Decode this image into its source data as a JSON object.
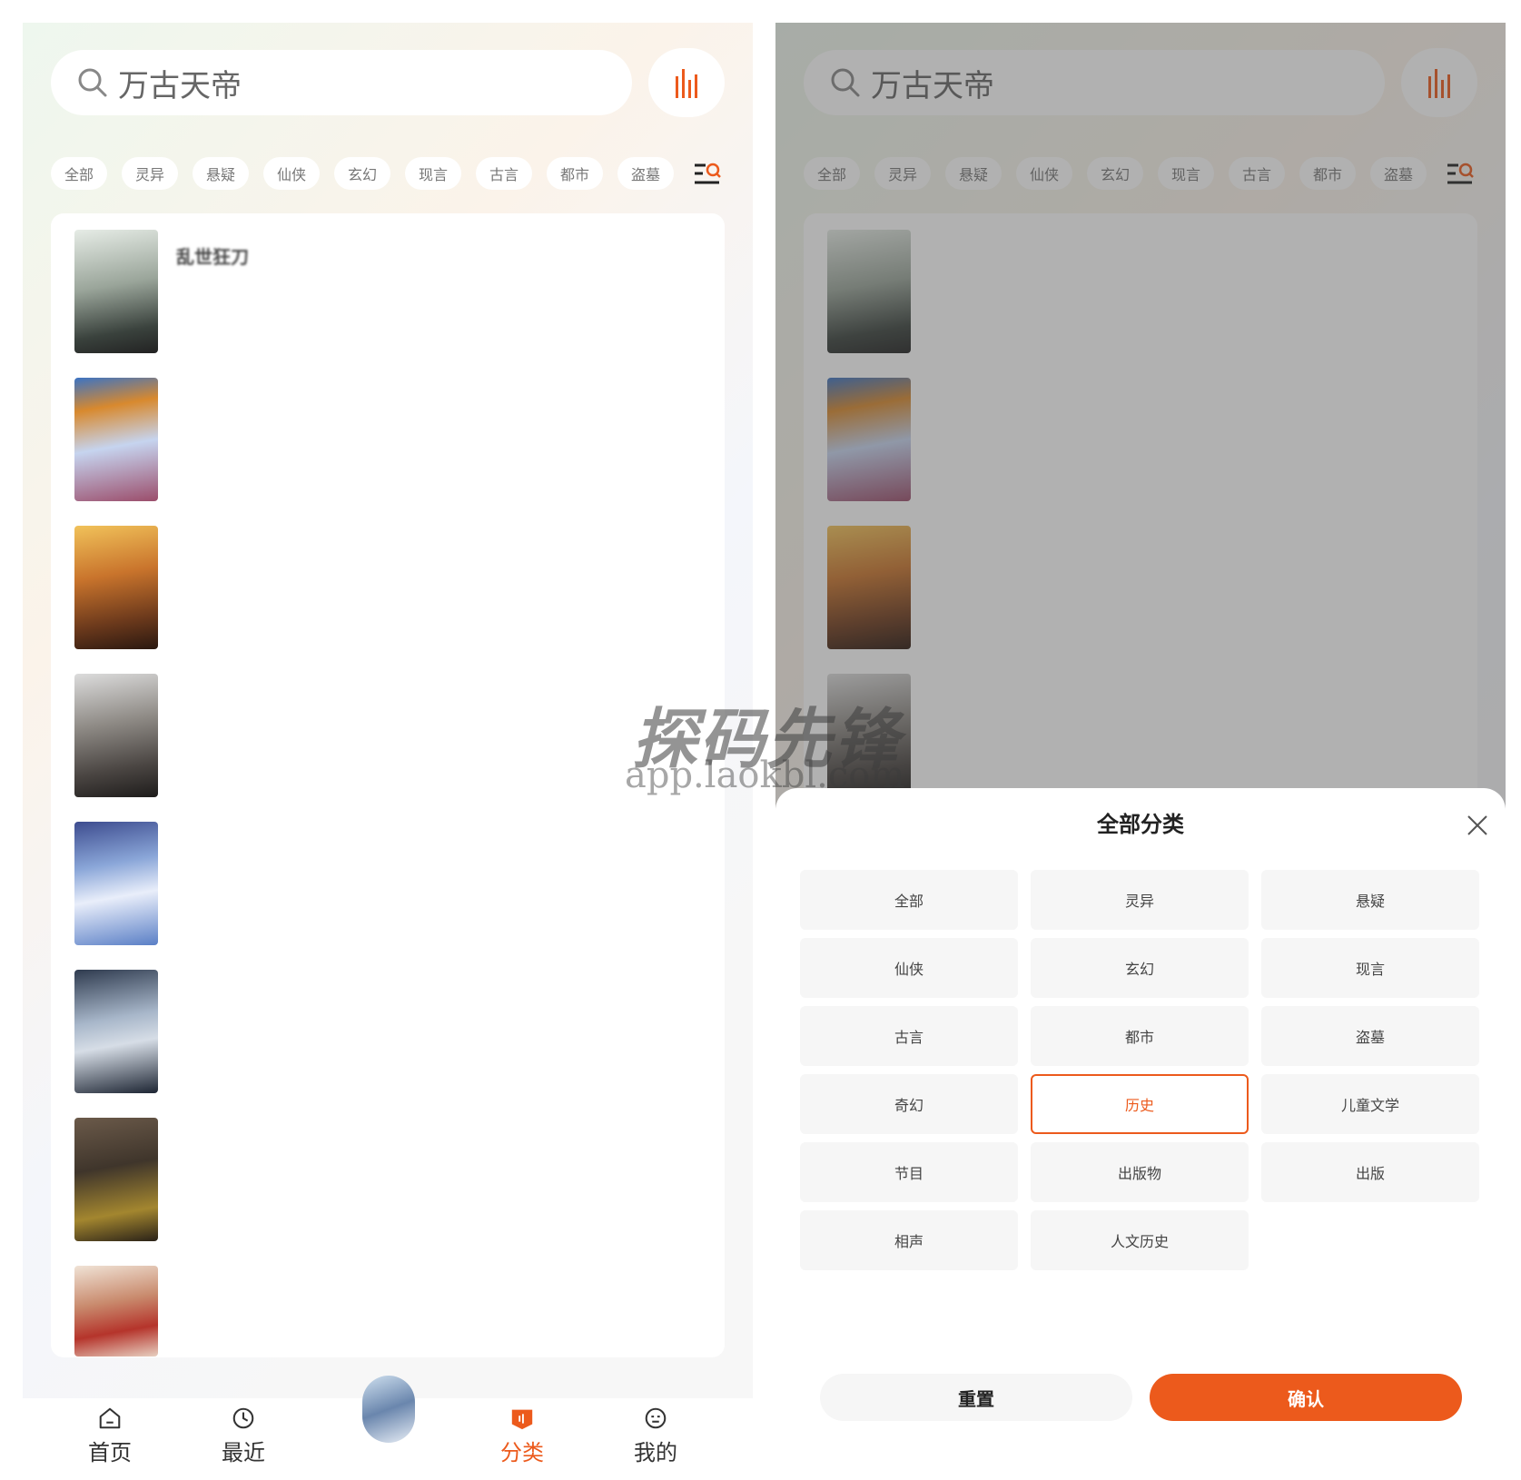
{
  "search": {
    "placeholder": "万古天帝"
  },
  "chips": [
    "全部",
    "灵异",
    "悬疑",
    "仙侠",
    "玄幻",
    "现言",
    "古言",
    "都市",
    "盗墓"
  ],
  "books": [
    {
      "title": "乱世狂刀",
      "desc": "",
      "count": ""
    },
    {
      "title": "",
      "desc": "",
      "count": ""
    },
    {
      "title": "",
      "desc": "",
      "count": ""
    },
    {
      "title": "",
      "desc": "",
      "count": ""
    },
    {
      "title": "",
      "desc": "",
      "count": ""
    },
    {
      "title": "",
      "desc": "",
      "count": ""
    },
    {
      "title": "",
      "desc": "",
      "count": ""
    },
    {
      "title": "",
      "desc": "",
      "count": ""
    }
  ],
  "tabbar": {
    "home": "首页",
    "recent": "最近",
    "category": "分类",
    "mine": "我的"
  },
  "sheet": {
    "title": "全部分类",
    "categories": [
      "全部",
      "灵异",
      "悬疑",
      "仙侠",
      "玄幻",
      "现言",
      "古言",
      "都市",
      "盗墓",
      "奇幻",
      "历史",
      "儿童文学",
      "节目",
      "出版物",
      "出版",
      "相声",
      "人文历史"
    ],
    "selected": "历史",
    "reset": "重置",
    "confirm": "确认"
  },
  "watermark": {
    "cn": "探码先锋",
    "en": "app.laokbl.com"
  },
  "colors": {
    "accent": "#ec5a1c",
    "card": "#ffffff",
    "chip_bg": "#ffffff",
    "sheet_cell": "#f6f6f6"
  },
  "icons": {
    "search": "search-icon",
    "voice": "voice-bars-icon",
    "filter": "filter-search-icon",
    "home": "home-icon",
    "recent": "clock-icon",
    "category": "category-icon",
    "mine": "profile-icon",
    "close": "close-icon"
  }
}
